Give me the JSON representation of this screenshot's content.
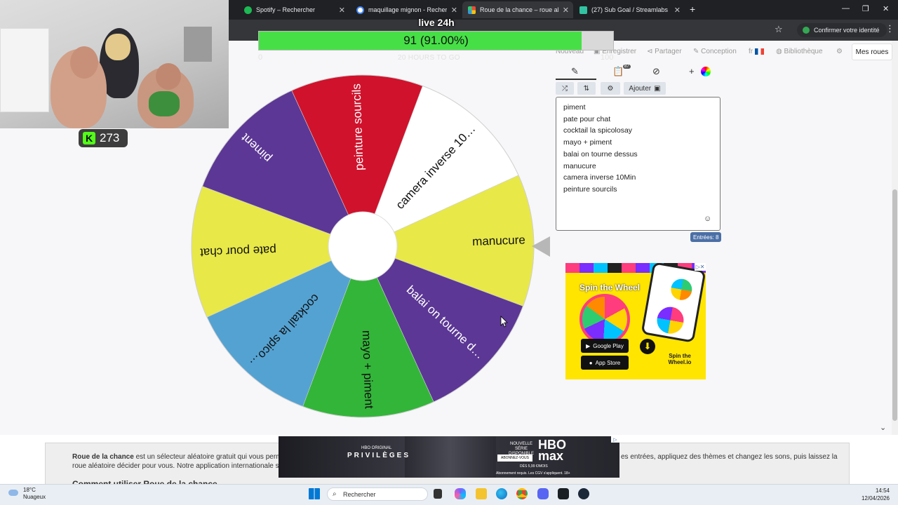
{
  "browser": {
    "tabs": [
      {
        "title": "Spotify – Rechercher",
        "color": "#1db954"
      },
      {
        "title": "maquillage mignon - Recherche",
        "color": "#4285f4"
      },
      {
        "title": "Roue de la chance – roue aléatoire",
        "color": "#e84c3d"
      },
      {
        "title": "(27) Sub Goal / Streamlabs",
        "color": "#31c3a2"
      }
    ],
    "new_tab": "+",
    "window_controls": [
      "—",
      "❐",
      "✕"
    ],
    "identity_button": "Confirmer votre identité",
    "bookmark_icon": "star-icon",
    "menu_icon": "⋮"
  },
  "overlay": {
    "title": "live 24h",
    "goal_text": "91 (91.00%)",
    "goal_fraction": 0.91,
    "goal_min": "0",
    "goal_remaining": "20 HOURS TO GO",
    "goal_max": "100",
    "kick_count": "273"
  },
  "nav": {
    "nouveau": "Nouveau",
    "enregistrer": "Enregistrer",
    "partager": "Partager",
    "conception": "Conception",
    "lang": "fr",
    "bibliotheque": "Bibliothèque",
    "mes_roues": "Mes roues"
  },
  "editor": {
    "badge_count": "87",
    "ajouter": "Ajouter",
    "entries": [
      "piment",
      "pate pour chat",
      "cocktail la spicolosay",
      "mayo + piment",
      "balai on tourne dessus",
      "manucure",
      "camera inverse 10Min",
      "peinture sourcils"
    ],
    "entries_badge": "Entrées: 8"
  },
  "wheel": {
    "segments": [
      {
        "label": "manucure",
        "color": "#e8e848"
      },
      {
        "label": "balai on tourne d…",
        "color": "#5c3795"
      },
      {
        "label": "mayo + piment",
        "color": "#33b53a"
      },
      {
        "label": "cocktail la spico…",
        "color": "#54a2d2"
      },
      {
        "label": "pate pour chat",
        "color": "#e8e848"
      },
      {
        "label": "piment",
        "color": "#5c3795"
      },
      {
        "label": "peinture sourcils",
        "color": "#d0122c"
      },
      {
        "label": "camera inverse 10…",
        "color": "#ffffff"
      }
    ]
  },
  "ad_spin": {
    "title": "Spin the Wheel",
    "google_play": "Google Play",
    "app_store": "App Store",
    "brand": "Spin the Wheel.io"
  },
  "article": {
    "bold": "Roue de la chance",
    "line1_start": " est un sélecteur aléatoire gratuit qui vous permet de",
    "line1_end": "es entrées, appliquez des thèmes et changez les sons, puis laissez la",
    "line2": "roue aléatoire décider pour vous. Notre application internationale s'app",
    "heading": "Comment utiliser Roue de la chance"
  },
  "hbo_ad": {
    "show_small": "HBO ORIGINAL",
    "show": "PRIVILÈGES",
    "new_series": "NOUVELLE SÉRIE DISPONIBLE",
    "subscribe": "ABONNEZ-VOUS",
    "logo": "HBO max",
    "price": "DÈS 5,99 €/MOIS",
    "mention": "Abonnement requis. Les CGV s'appliquent. 18+"
  },
  "taskbar": {
    "temp": "18°C",
    "weather": "Nuageux",
    "search": "Rechercher",
    "time": "14:54",
    "date": "12/04/2026"
  }
}
